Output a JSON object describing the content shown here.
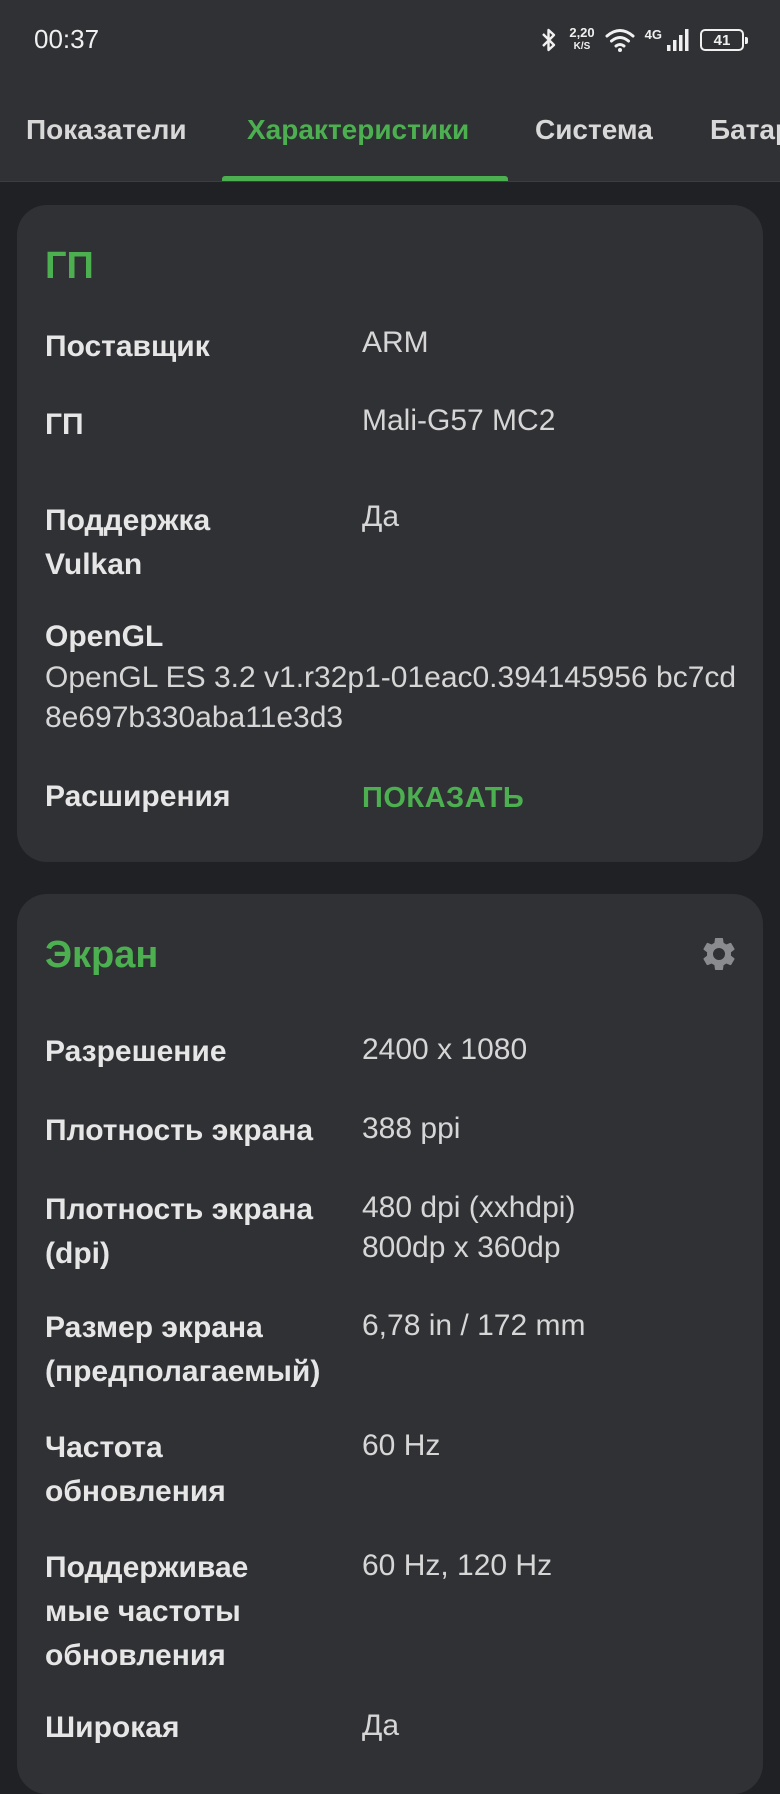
{
  "status_bar": {
    "time": "00:37",
    "net_speed_value": "2,20",
    "net_speed_unit": "K/S",
    "network_type": "4G",
    "battery_level": "41",
    "icons": [
      "bluetooth-icon",
      "wifi-icon",
      "signal-icon",
      "battery-icon"
    ]
  },
  "tabs": [
    {
      "label": "Показатели",
      "active": false
    },
    {
      "label": "Характеристики",
      "active": true
    },
    {
      "label": "Система",
      "active": false
    },
    {
      "label": "Батар",
      "active": false
    }
  ],
  "gpu_card": {
    "title": "ГП",
    "rows": [
      {
        "label": "Поставщик",
        "value": "ARM"
      },
      {
        "label": "ГП",
        "value": "Mali-G57 MC2"
      },
      {
        "label": "Поддержка Vulkan",
        "value": "Да"
      }
    ],
    "opengl_label": "OpenGL",
    "opengl_value": "OpenGL ES 3.2 v1.r32p1-01eac0.394145956 bc7cd8e697b330aba11e3d3",
    "extensions_label": "Расширения",
    "extensions_button": "ПОКАЗАТЬ"
  },
  "screen_card": {
    "title": "Экран",
    "settings_icon": "gear-icon",
    "rows": [
      {
        "label": "Разрешение",
        "value": "2400 x 1080"
      },
      {
        "label": "Плотность экрана",
        "value": "388 ppi"
      },
      {
        "label": "Плотность экрана (dpi)",
        "value": "480 dpi (xxhdpi) 800dp x 360dp"
      },
      {
        "label": "Размер экрана (предполагаемый)",
        "value": "6,78 in / 172 mm"
      },
      {
        "label": "Частота обновления",
        "value": "60 Hz"
      },
      {
        "label": "Поддерживае мые частоты обновления",
        "value": "60 Hz, 120 Hz"
      },
      {
        "label": "Широкая",
        "value": "Да"
      }
    ]
  },
  "colors": {
    "accent": "#4caf50",
    "background": "#202124",
    "card": "#303134"
  }
}
